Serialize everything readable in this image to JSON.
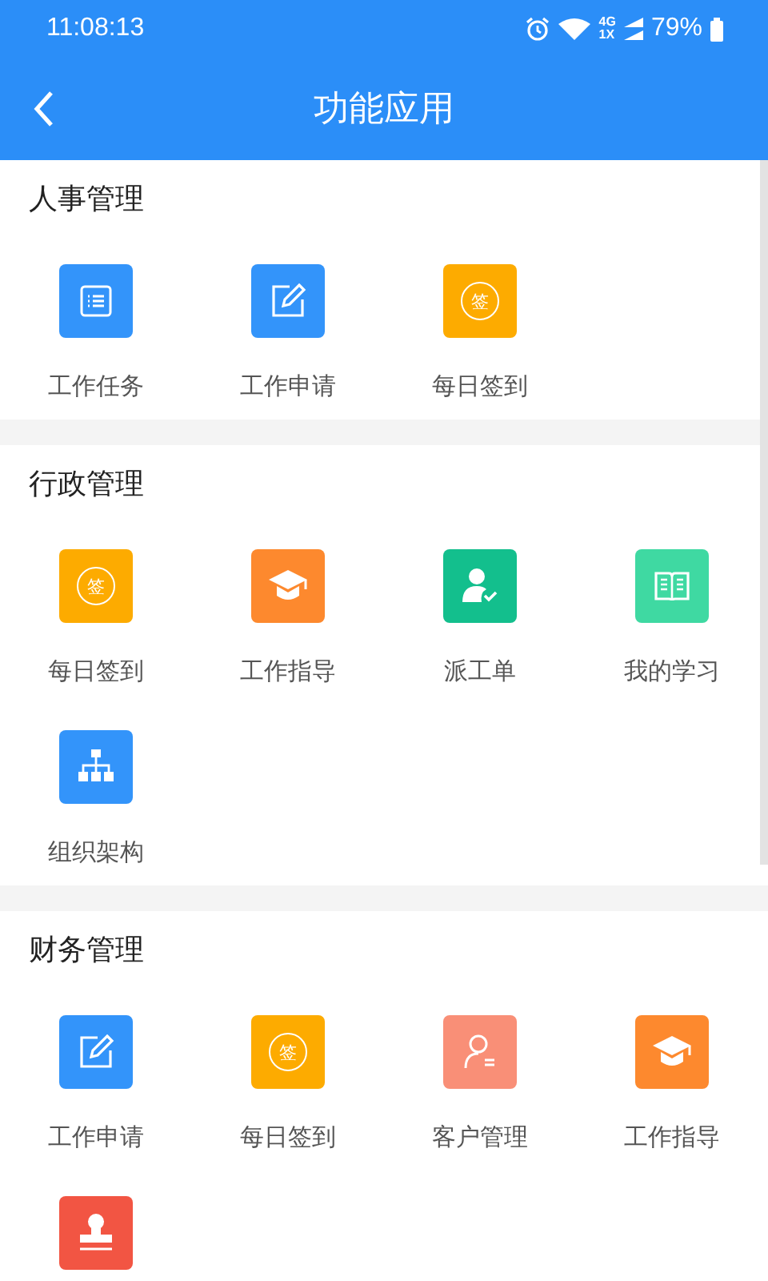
{
  "status_bar": {
    "time": "11:08:13",
    "network": "4G",
    "network2": "1X",
    "battery": "79%"
  },
  "header": {
    "title": "功能应用"
  },
  "sections": [
    {
      "title": "人事管理",
      "items": [
        {
          "label": "工作任务",
          "kind": "list",
          "color": "#3394fa"
        },
        {
          "label": "工作申请",
          "kind": "edit",
          "color": "#3394fa"
        },
        {
          "label": "每日签到",
          "kind": "sign",
          "color": "#fdab00",
          "glyph": "签"
        }
      ]
    },
    {
      "title": "行政管理",
      "items": [
        {
          "label": "每日签到",
          "kind": "sign",
          "color": "#fdab00",
          "glyph": "签"
        },
        {
          "label": "工作指导",
          "kind": "cap",
          "color": "#fd892e"
        },
        {
          "label": "派工单",
          "kind": "worker",
          "color": "#13bf8d"
        },
        {
          "label": "我的学习",
          "kind": "book",
          "color": "#3fd9a2"
        },
        {
          "label": "组织架构",
          "kind": "org",
          "color": "#3394fa"
        }
      ]
    },
    {
      "title": "财务管理",
      "items": [
        {
          "label": "工作申请",
          "kind": "edit",
          "color": "#3394fa"
        },
        {
          "label": "每日签到",
          "kind": "sign",
          "color": "#fdab00",
          "glyph": "签"
        },
        {
          "label": "客户管理",
          "kind": "customer",
          "color": "#f98f77"
        },
        {
          "label": "工作指导",
          "kind": "cap",
          "color": "#fd892e"
        },
        {
          "kind": "stamp",
          "color": "#f25543"
        }
      ]
    }
  ]
}
